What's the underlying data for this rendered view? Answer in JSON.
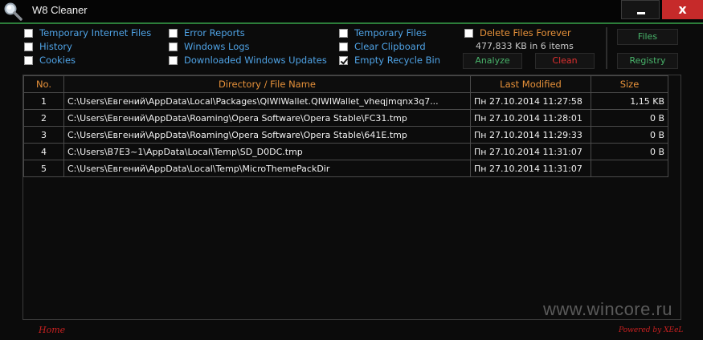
{
  "window": {
    "title": "W8 Cleaner",
    "minimize_icon": "minimize-icon",
    "close_label": "x",
    "accent_color": "#2c7d3a"
  },
  "options": {
    "col1": [
      {
        "label": "Temporary Internet Files",
        "checked": false
      },
      {
        "label": "History",
        "checked": false
      },
      {
        "label": "Cookies",
        "checked": false
      }
    ],
    "col2": [
      {
        "label": "Error Reports",
        "checked": false
      },
      {
        "label": "Windows Logs",
        "checked": false
      },
      {
        "label": "Downloaded Windows Updates",
        "checked": false
      }
    ],
    "col3": [
      {
        "label": "Temporary  Files",
        "checked": false
      },
      {
        "label": "Clear Clipboard",
        "checked": false
      },
      {
        "label": "Empty Recycle Bin",
        "checked": true
      }
    ],
    "delete_forever": {
      "label": "Delete Files Forever",
      "checked": false
    },
    "summary": "477,833 KB in 6 items"
  },
  "buttons": {
    "analyze": "Analyze",
    "clean": "Clean",
    "files": "Files",
    "registry": "Registry"
  },
  "table": {
    "headers": [
      "No.",
      "Directory / File   Name",
      "Last Modified",
      "Size"
    ],
    "rows": [
      {
        "no": "1",
        "path": "C:\\Users\\Евгений\\AppData\\Local\\Packages\\QIWIWallet.QIWIWallet_vheqjmqnx3q7...",
        "modified": "Пн 27.10.2014 11:27:58",
        "size": "1,15 KB"
      },
      {
        "no": "2",
        "path": "C:\\Users\\Евгений\\AppData\\Roaming\\Opera Software\\Opera Stable\\FC31.tmp",
        "modified": "Пн 27.10.2014 11:28:01",
        "size": "0 B"
      },
      {
        "no": "3",
        "path": "C:\\Users\\Евгений\\AppData\\Roaming\\Opera Software\\Opera Stable\\641E.tmp",
        "modified": "Пн 27.10.2014 11:29:33",
        "size": "0 B"
      },
      {
        "no": "4",
        "path": "C:\\Users\\B7E3~1\\AppData\\Local\\Temp\\SD_D0DC.tmp",
        "modified": "Пн 27.10.2014 11:31:07",
        "size": "0 B"
      },
      {
        "no": "5",
        "path": "C:\\Users\\Евгений\\AppData\\Local\\Temp\\MicroThemePackDir",
        "modified": "Пн 27.10.2014 11:31:07",
        "size": ""
      }
    ]
  },
  "footer": {
    "home": "Home",
    "powered_by": "Powered by XEeL",
    "watermark": "www.wincore.ru"
  }
}
